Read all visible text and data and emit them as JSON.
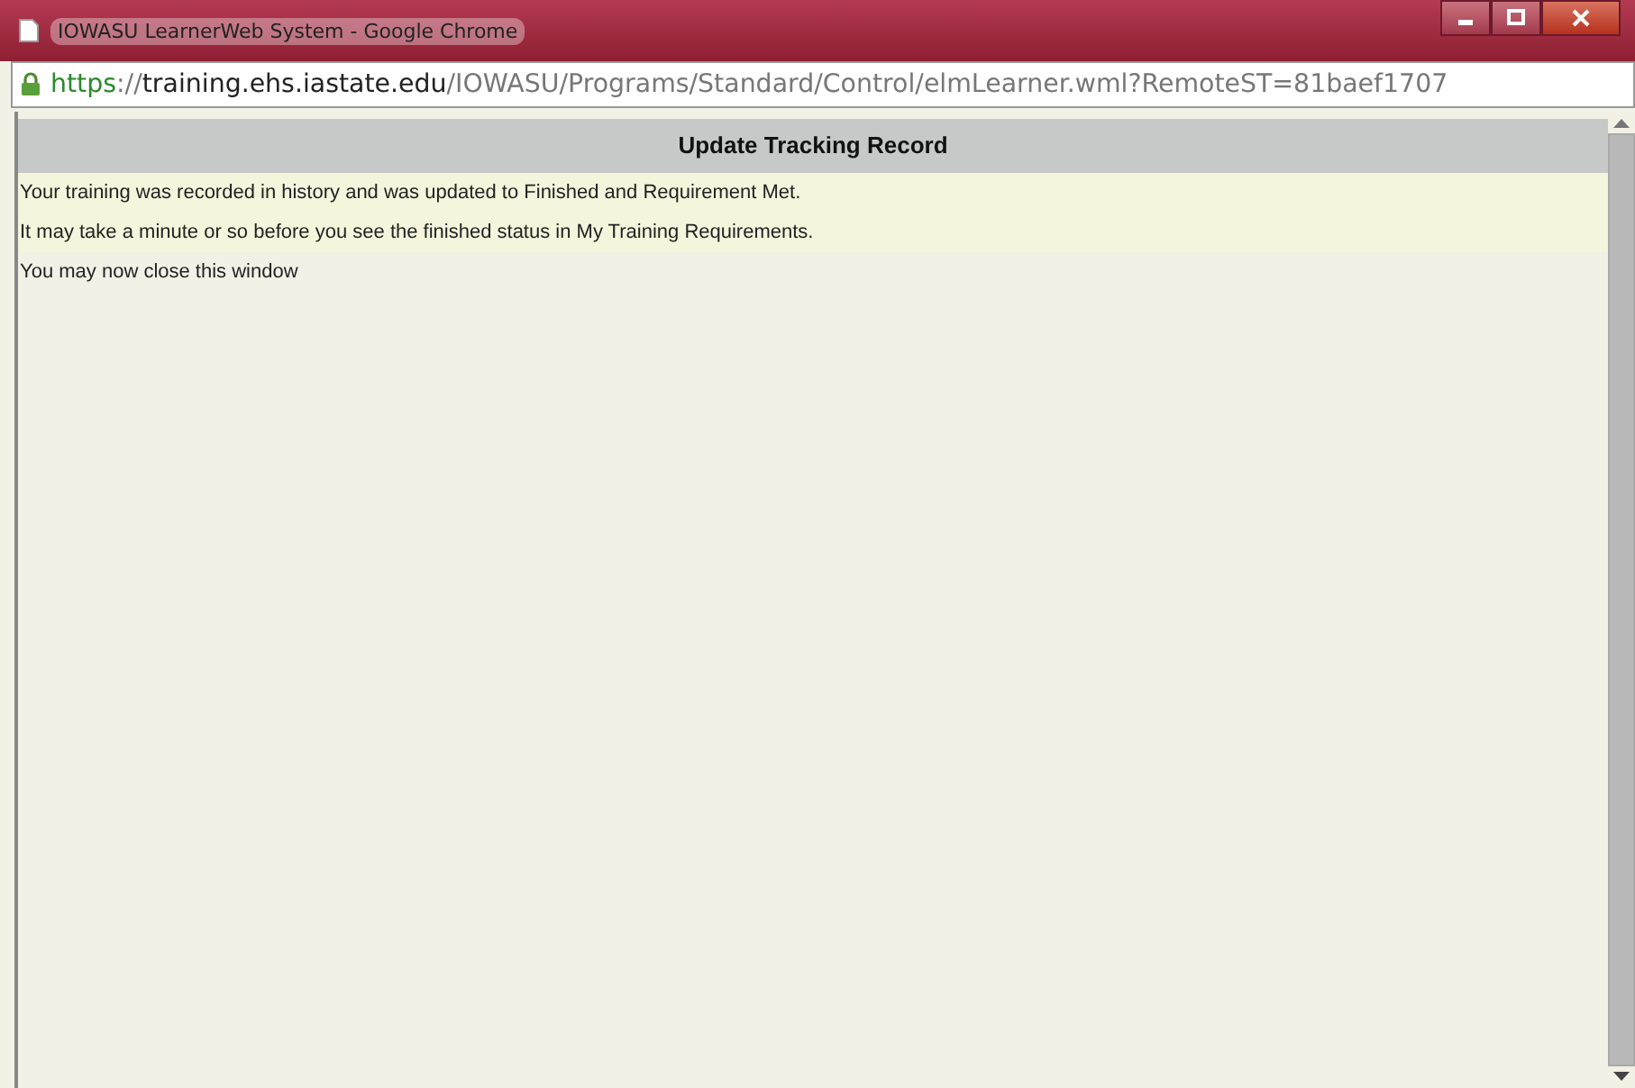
{
  "window": {
    "title": "IOWASU LearnerWeb System - Google Chrome"
  },
  "address_bar": {
    "scheme": "https",
    "separator": "://",
    "host": "training.ehs.iastate.edu",
    "path": "/IOWASU/Programs/Standard/Control/elmLearner.wml?RemoteST=81baef1707"
  },
  "page": {
    "heading": "Update Tracking Record",
    "messages": [
      "Your training was recorded in history and was updated to Finished and Requirement Met.",
      "It may take a minute or so before you see the finished status in My Training Requirements.",
      "You may now close this window"
    ]
  }
}
